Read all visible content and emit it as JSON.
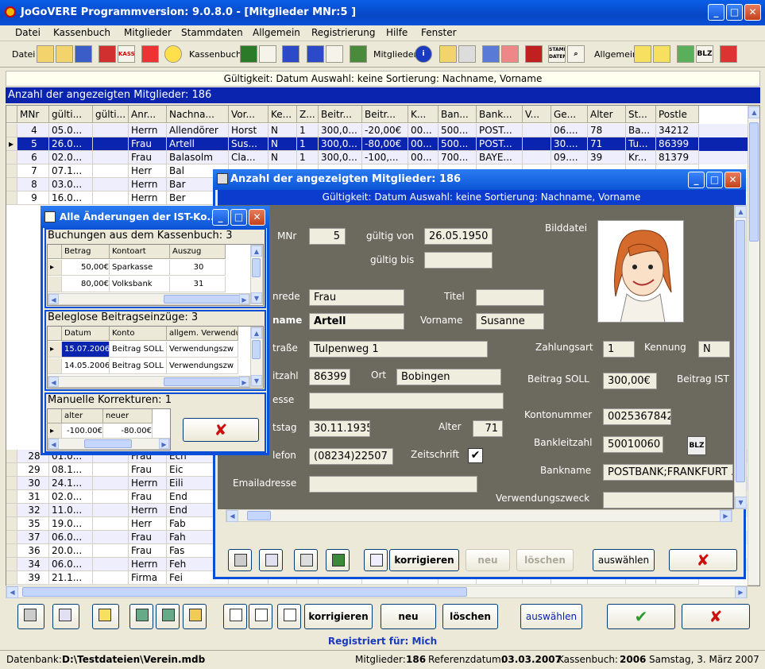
{
  "window": {
    "title": "JoGoVERE Programmversion: 9.0.8.0 - [Mitglieder MNr:5 ]"
  },
  "menu": [
    "Datei",
    "Kassenbuch",
    "Mitglieder",
    "Stammdaten",
    "Allgemein",
    "Registrierung",
    "Hilfe",
    "Fenster"
  ],
  "toolbar": {
    "datei": "Datei",
    "kassenbuch": "Kassenbuch",
    "mitglieder": "Mitglieder",
    "allgemein": "Allgemein",
    "stamm": "STAMM DATEN",
    "blz": "BLZ",
    "kasse": "KASSE"
  },
  "info_bar": "Gültigkeit: Datum   Auswahl: keine   Sortierung: Nachname, Vorname",
  "count_bar": "Anzahl der angezeigten Mitglieder: 186",
  "grid": {
    "headers": [
      "MNr",
      "gülti...",
      "gülti...",
      "Anr...",
      "Nachna...",
      "Vor...",
      "Ke...",
      "Z...",
      "Beitr...",
      "Beitr...",
      "K...",
      "Ban...",
      "Bank...",
      "V...",
      "Ge...",
      "Alter",
      "St...",
      "Postle"
    ],
    "rows": [
      [
        "4",
        "05.0...",
        "",
        "Herrn",
        "Allendörer",
        "Horst",
        "N",
        "1",
        "300,0...",
        "-20,00€",
        "00...",
        "500...",
        "POST...",
        "",
        "06....",
        "78",
        "Ba...",
        "34212"
      ],
      [
        "5",
        "26.0...",
        "",
        "Frau",
        "Artell",
        "Sus...",
        "N",
        "1",
        "300,0...",
        "-80,00€",
        "00...",
        "500...",
        "POST...",
        "",
        "30....",
        "71",
        "Tu...",
        "86399"
      ],
      [
        "6",
        "02.0...",
        "",
        "Frau",
        "Balasolm",
        "Cla...",
        "N",
        "1",
        "300,0...",
        "-100,...",
        "00...",
        "700...",
        "BAYE...",
        "",
        "09....",
        "39",
        "Kr...",
        "81379"
      ],
      [
        "7",
        "07.1...",
        "",
        "Herr",
        "Bal",
        "",
        "",
        "",
        "",
        "",
        "",
        "",
        "",
        "",
        "",
        "",
        "",
        ""
      ],
      [
        "8",
        "03.0...",
        "",
        "Herrn",
        "Bar",
        "",
        "",
        "",
        "",
        "",
        "",
        "",
        "",
        "",
        "",
        "",
        "",
        ""
      ],
      [
        "9",
        "16.0...",
        "",
        "Herrn",
        "Ber",
        "",
        "",
        "",
        "",
        "",
        "",
        "",
        "",
        "",
        "",
        "",
        "",
        ""
      ],
      [
        "28",
        "01.0...",
        "",
        "Frau",
        "Ech",
        "",
        "",
        "",
        "",
        "",
        "",
        "",
        "",
        "",
        "",
        "",
        "",
        ""
      ],
      [
        "29",
        "08.1...",
        "",
        "Frau",
        "Eic",
        "",
        "",
        "",
        "",
        "",
        "",
        "",
        "",
        "",
        "",
        "",
        "",
        ""
      ],
      [
        "30",
        "24.1...",
        "",
        "Herrn",
        "Eili",
        "",
        "",
        "",
        "",
        "",
        "",
        "",
        "",
        "",
        "",
        "",
        "",
        ""
      ],
      [
        "31",
        "02.0...",
        "",
        "Frau",
        "End",
        "",
        "",
        "",
        "",
        "",
        "",
        "",
        "",
        "",
        "",
        "",
        "",
        ""
      ],
      [
        "32",
        "11.0...",
        "",
        "Herrn",
        "End",
        "",
        "",
        "",
        "",
        "",
        "",
        "",
        "",
        "",
        "",
        "",
        "",
        ""
      ],
      [
        "35",
        "19.0...",
        "",
        "Herr",
        "Fab",
        "",
        "",
        "",
        "",
        "",
        "",
        "",
        "",
        "",
        "",
        "",
        "",
        ""
      ],
      [
        "37",
        "06.0...",
        "",
        "Frau",
        "Fah",
        "",
        "",
        "",
        "",
        "",
        "",
        "",
        "",
        "",
        "",
        "",
        "",
        ""
      ],
      [
        "36",
        "20.0...",
        "",
        "Frau",
        "Fas",
        "",
        "",
        "",
        "",
        "",
        "",
        "",
        "",
        "",
        "",
        "",
        "",
        ""
      ],
      [
        "34",
        "06.0...",
        "",
        "Herrn",
        "Feh",
        "",
        "",
        "",
        "",
        "",
        "",
        "",
        "",
        "",
        "",
        "",
        "",
        ""
      ],
      [
        "39",
        "21.1...",
        "",
        "Firma",
        "Fei",
        "",
        "",
        "",
        "",
        "",
        "",
        "",
        "",
        "",
        "",
        "",
        "",
        ""
      ]
    ]
  },
  "detail": {
    "title": "Anzahl der angezeigten Mitglieder: 186",
    "info": "Gültigkeit: Datum   Auswahl: keine   Sortierung: Nachname, Vorname",
    "labels": {
      "mnr": "MNr",
      "gueltig_von": "gültig von",
      "gueltig_bis": "gültig bis",
      "bilddatei": "Bilddatei",
      "anrede": "nrede",
      "titel": "Titel",
      "name": "name",
      "vorname": "Vorname",
      "strasse": "traße",
      "zahlungsart": "Zahlungsart",
      "kennung": "Kennung",
      "plz": "itzahl",
      "ort": "Ort",
      "beitrag_soll": "Beitrag SOLL",
      "beitrag_ist": "Beitrag IST",
      "adresse": "esse",
      "kontonummer": "Kontonummer",
      "geburtstag": "tstag",
      "alter": "Alter",
      "bankleitzahl": "Bankleitzahl",
      "telefon": "lefon",
      "zeitschrift": "Zeitschrift",
      "bankname": "Bankname",
      "email": "Emailadresse",
      "verwendungszweck": "Verwendungszweck"
    },
    "values": {
      "mnr": "5",
      "gueltig_von": "26.05.1950",
      "gueltig_bis": "",
      "anrede": "Frau",
      "titel": "",
      "name": "Artell",
      "vorname": "Susanne",
      "strasse": "Tulpenweg 1",
      "zahlungsart": "1",
      "kennung": "N",
      "plz": "86399",
      "ort": "Bobingen",
      "beitrag_soll": "300,00€",
      "adresse": "",
      "kontonummer": "0025367842",
      "geburtstag": "30.11.1935",
      "alter": "71",
      "bankleitzahl": "50010060",
      "telefon": "(08234)22507",
      "bankname": "POSTBANK;FRANKFURT ...",
      "email": "",
      "verwendungszweck": ""
    },
    "blz_button": "BLZ",
    "buttons": {
      "korrigieren": "korrigieren",
      "neu": "neu",
      "loeschen": "löschen",
      "auswaehlen": "auswählen"
    }
  },
  "changes": {
    "title": "Alle Änderungen der IST-Ko...",
    "kassenbuch": {
      "header": "Buchungen aus dem Kassenbuch: 3",
      "cols": [
        "Betrag",
        "Kontoart",
        "Auszug"
      ],
      "rows": [
        [
          "50,00€",
          "Sparkasse",
          "30"
        ],
        [
          "80,00€",
          "Volksbank",
          "31"
        ]
      ]
    },
    "belegl": {
      "header": "Beleglose Beitragseinzüge: 3",
      "cols": [
        "Datum",
        "Konto",
        "allgem. Verwendu"
      ],
      "rows": [
        [
          "15.07.2006",
          "Beitrag SOLL",
          "Verwendungszw"
        ],
        [
          "14.05.2006",
          "Beitrag SOLL",
          "Verwendungszw"
        ]
      ]
    },
    "manuell": {
      "header": "Manuelle Korrekturen: 1",
      "cols": [
        "alter",
        "neuer"
      ],
      "rows": [
        [
          "-100.00€",
          "-80.00€"
        ]
      ]
    }
  },
  "bottom_buttons": {
    "korrigieren": "korrigieren",
    "neu": "neu",
    "loeschen": "löschen",
    "auswaehlen": "auswählen"
  },
  "registered": "Registriert für: Mich",
  "status": {
    "db_label": "Datenbank:",
    "db_path": "D:\\Testdateien\\Verein.mdb",
    "members_label": "Mitglieder:",
    "members": "186",
    "ref_label": "Referenzdatum:",
    "ref_date": "03.03.2007",
    "kb_label": "Kassenbuch:",
    "kb_year": "2006",
    "date": "Samstag, 3. März 2007"
  },
  "colors": {
    "titlebar": "#0a4fd8",
    "selection": "#0a24b0",
    "form_bg": "#6c6a5e",
    "ok_green": "#2a9a2a",
    "cancel_red": "#cc1010"
  }
}
